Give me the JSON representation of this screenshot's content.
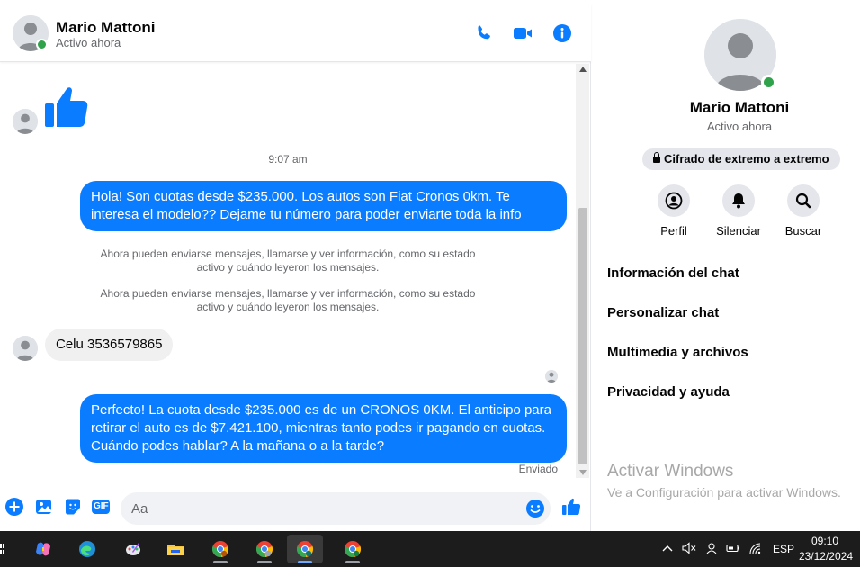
{
  "header": {
    "name": "Mario Mattoni",
    "status": "Activo ahora",
    "icons": [
      "phone-icon",
      "video-icon",
      "info-icon"
    ]
  },
  "colors": {
    "accent": "#0a7cff",
    "online": "#31a24c",
    "bubble_in": "#f0f0f0"
  },
  "messages": {
    "timestamp": "9:07 am",
    "out_1": "Hola! Son cuotas desde $235.000. Los autos son Fiat Cronos 0km. Te interesa el modelo?? Dejame tu número para poder enviarte toda la info",
    "system_1": "Ahora pueden enviarse mensajes, llamarse y ver información, como su estado activo y cuándo leyeron los mensajes.",
    "system_2": "Ahora pueden enviarse mensajes, llamarse y ver información, como su estado activo y cuándo leyeron los mensajes.",
    "in_1": "Celu 3536579865",
    "out_2": "Perfecto! La cuota desde $235.000 es de un CRONOS 0KM. El anticipo para retirar el auto es de $7.421.100, mientras tanto podes ir pagando en cuotas. Cuándo podes hablar? A la mañana o a la tarde?",
    "sent_status": "Enviado"
  },
  "composer": {
    "placeholder": "Aa",
    "gif_label": "GIF"
  },
  "info": {
    "name": "Mario Mattoni",
    "status": "Activo ahora",
    "e2e": "Cifrado de extremo a extremo",
    "actions": [
      {
        "label": "Perfil",
        "icon": "profile-icon"
      },
      {
        "label": "Silenciar",
        "icon": "bell-icon"
      },
      {
        "label": "Buscar",
        "icon": "search-icon"
      }
    ],
    "menu": [
      "Información del chat",
      "Personalizar chat",
      "Multimedia y archivos",
      "Privacidad y ayuda"
    ]
  },
  "watermark": {
    "title": "Activar Windows",
    "subtitle": "Ve a Configuración para activar Windows."
  },
  "taskbar": {
    "language": "ESP",
    "time": "09:10",
    "date": "23/12/2024"
  }
}
